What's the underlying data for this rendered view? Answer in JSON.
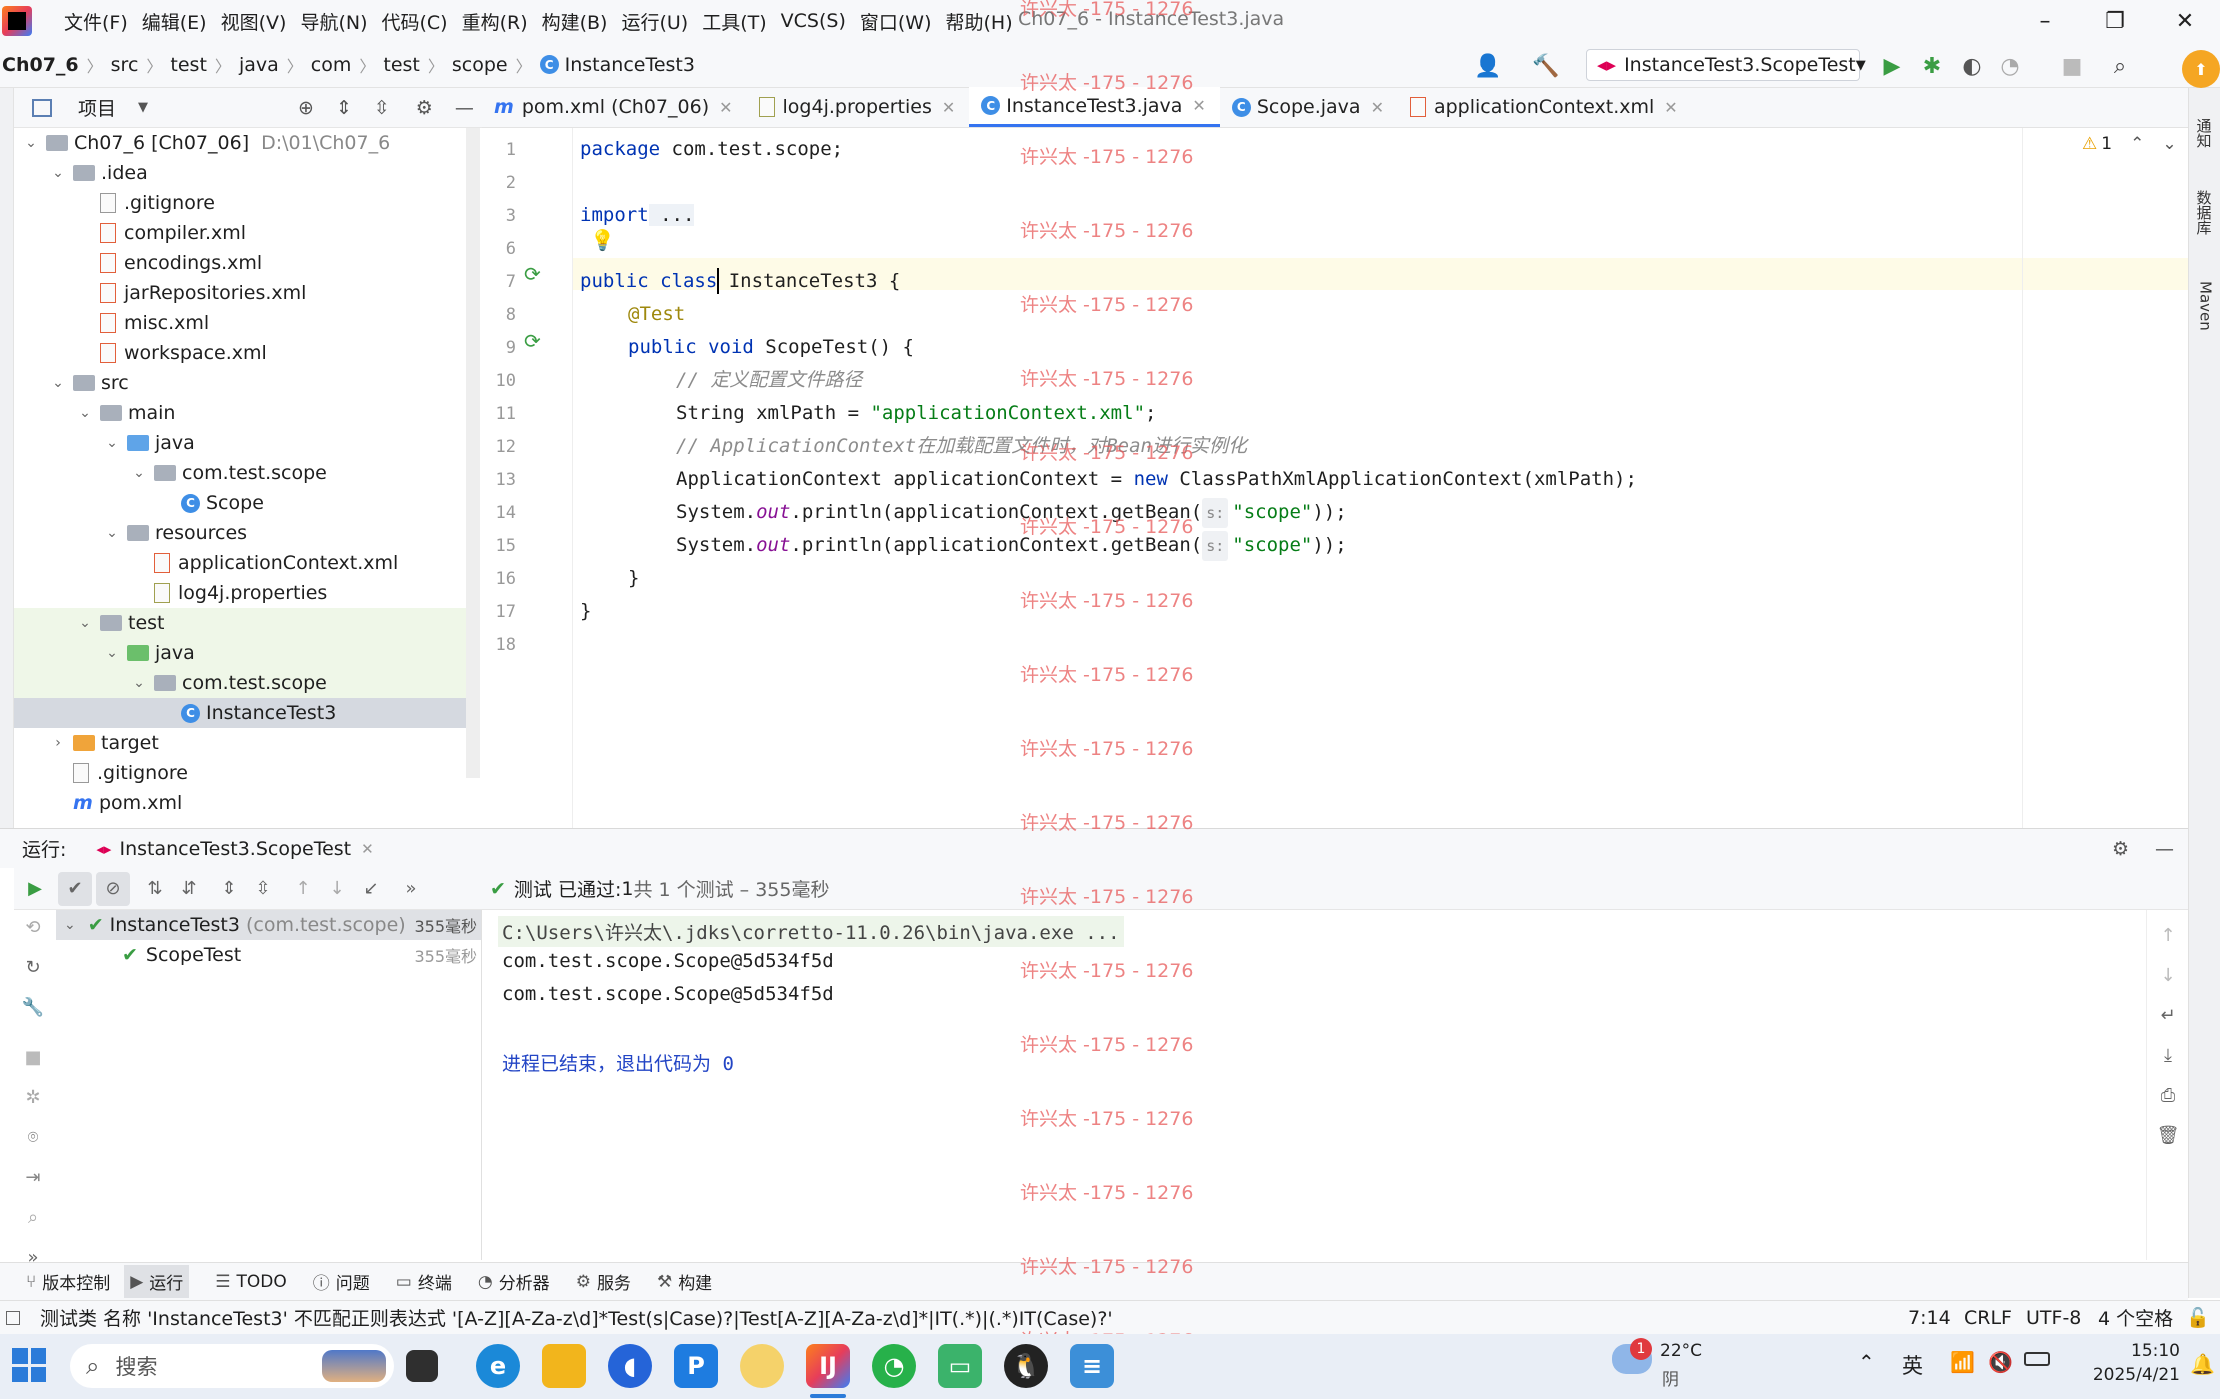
{
  "app": {
    "title": "Ch07_6 - InstanceTest3.java",
    "menu": [
      "文件(F)",
      "编辑(E)",
      "视图(V)",
      "导航(N)",
      "代码(C)",
      "重构(R)",
      "构建(B)",
      "运行(U)",
      "工具(T)",
      "VCS(S)",
      "窗口(W)",
      "帮助(H)"
    ]
  },
  "breadcrumb": {
    "project": "Ch07_6",
    "parts": [
      "src",
      "test",
      "java",
      "com",
      "test",
      "scope"
    ],
    "file": "InstanceTest3"
  },
  "toolbar": {
    "run_config": "InstanceTest3.ScopeTest"
  },
  "project_panel": {
    "title": "项目"
  },
  "tree": [
    {
      "indent": 0,
      "arrow": "⌄",
      "icon": "folder",
      "name": "Ch07_6 [Ch07_06]",
      "extra": "D:\\01\\Ch07_6",
      "bold": true
    },
    {
      "indent": 1,
      "arrow": "⌄",
      "icon": "folder",
      "name": ".idea"
    },
    {
      "indent": 2,
      "arrow": "",
      "icon": "file",
      "name": ".gitignore"
    },
    {
      "indent": 2,
      "arrow": "",
      "icon": "xml",
      "name": "compiler.xml"
    },
    {
      "indent": 2,
      "arrow": "",
      "icon": "xml",
      "name": "encodings.xml"
    },
    {
      "indent": 2,
      "arrow": "",
      "icon": "xml",
      "name": "jarRepositories.xml"
    },
    {
      "indent": 2,
      "arrow": "",
      "icon": "xml",
      "name": "misc.xml"
    },
    {
      "indent": 2,
      "arrow": "",
      "icon": "xml",
      "name": "workspace.xml"
    },
    {
      "indent": 1,
      "arrow": "⌄",
      "icon": "folder",
      "name": "src"
    },
    {
      "indent": 2,
      "arrow": "⌄",
      "icon": "folder",
      "name": "main"
    },
    {
      "indent": 3,
      "arrow": "⌄",
      "icon": "blue",
      "name": "java"
    },
    {
      "indent": 4,
      "arrow": "⌄",
      "icon": "pkg",
      "name": "com.test.scope"
    },
    {
      "indent": 5,
      "arrow": "",
      "icon": "class",
      "name": "Scope"
    },
    {
      "indent": 3,
      "arrow": "⌄",
      "icon": "folder",
      "name": "resources"
    },
    {
      "indent": 4,
      "arrow": "",
      "icon": "xml",
      "name": "applicationContext.xml"
    },
    {
      "indent": 4,
      "arrow": "",
      "icon": "prop",
      "name": "log4j.properties"
    },
    {
      "indent": 2,
      "arrow": "⌄",
      "icon": "folder",
      "name": "test"
    },
    {
      "indent": 3,
      "arrow": "⌄",
      "icon": "green",
      "name": "java"
    },
    {
      "indent": 4,
      "arrow": "⌄",
      "icon": "pkg",
      "name": "com.test.scope"
    },
    {
      "indent": 5,
      "arrow": "",
      "icon": "class",
      "name": "InstanceTest3",
      "selected": true
    },
    {
      "indent": 1,
      "arrow": "›",
      "icon": "orange",
      "name": "target"
    },
    {
      "indent": 1,
      "arrow": "",
      "icon": "file",
      "name": ".gitignore"
    },
    {
      "indent": 1,
      "arrow": "",
      "icon": "maven",
      "name": "pom.xml"
    }
  ],
  "tabs": [
    "pom.xml (Ch07_06)",
    "log4j.properties",
    "InstanceTest3.java",
    "Scope.java",
    "applicationContext.xml"
  ],
  "active_tab": 2,
  "editor": {
    "warnings": "1",
    "line_numbers": [
      "1",
      "2",
      "3",
      "6",
      "7",
      "8",
      "9",
      "10",
      "11",
      "12",
      "13",
      "14",
      "15",
      "16",
      "17",
      "18"
    ]
  },
  "code": {
    "l1a": "package",
    "l1b": " com.test.scope;",
    "l3a": "import",
    "l3b": " ...",
    "l7a": "public class ",
    "l7b": "InstanceTest3 {",
    "l8": "@Test",
    "l9a": "public void ",
    "l9b": "ScopeTest() {",
    "l10": "// 定义配置文件路径",
    "l11a": "String xmlPath = ",
    "l11b": "\"applicationContext.xml\"",
    "l11c": ";",
    "l12": "// ApplicationContext在加载配置文件时，对Bean进行实例化",
    "l13a": "ApplicationContext applicationContext = ",
    "l13b": "new",
    "l13c": " ClassPathXmlApplicationContext(xmlPath);",
    "l14a": "System.",
    "l14b": "out",
    "l14c": ".println(applicationContext.getBean(",
    "l14hint": "s:",
    "l14d": "\"scope\"",
    "l14e": "));",
    "l16": "}",
    "l17": "}"
  },
  "run": {
    "label": "运行:",
    "tab": "InstanceTest3.ScopeTest",
    "status_prefix": "测试 已通过: ",
    "status_count": "1",
    "status_rest": "共 1 个测试 – 355毫秒",
    "tests": [
      {
        "name": "InstanceTest3",
        "pkg": "(com.test.scope)",
        "time": "355毫秒"
      },
      {
        "name": "ScopeTest",
        "time": "355毫秒"
      }
    ],
    "console": [
      "C:\\Users\\许兴太\\.jdks\\corretto-11.0.26\\bin\\java.exe ...",
      "com.test.scope.Scope@5d534f5d",
      "com.test.scope.Scope@5d534f5d",
      "",
      "进程已结束，退出代码为 0"
    ]
  },
  "bottom_tools": [
    "版本控制",
    "运行",
    "TODO",
    "问题",
    "终端",
    "分析器",
    "服务",
    "构建"
  ],
  "statusbar": {
    "message": "测试类 名称 'InstanceTest3' 不匹配正则表达式 '[A-Z][A-Za-z\\d]*Test(s|Case)?|Test[A-Z][A-Za-z\\d]*|IT(.*)|(.*)IT(Case)?'",
    "pos": "7:14",
    "eol": "CRLF",
    "enc": "UTF-8",
    "indent": "4 个空格"
  },
  "right_tools": [
    "通知",
    "数据库",
    "Maven"
  ],
  "watermark": "许兴太 -175 - 1276",
  "taskbar": {
    "search": "搜索",
    "weather_temp": "22°C",
    "weather_desc": "阴",
    "weather_badge": "1",
    "ime": "英",
    "time": "15:10",
    "date": "2025/4/21"
  }
}
